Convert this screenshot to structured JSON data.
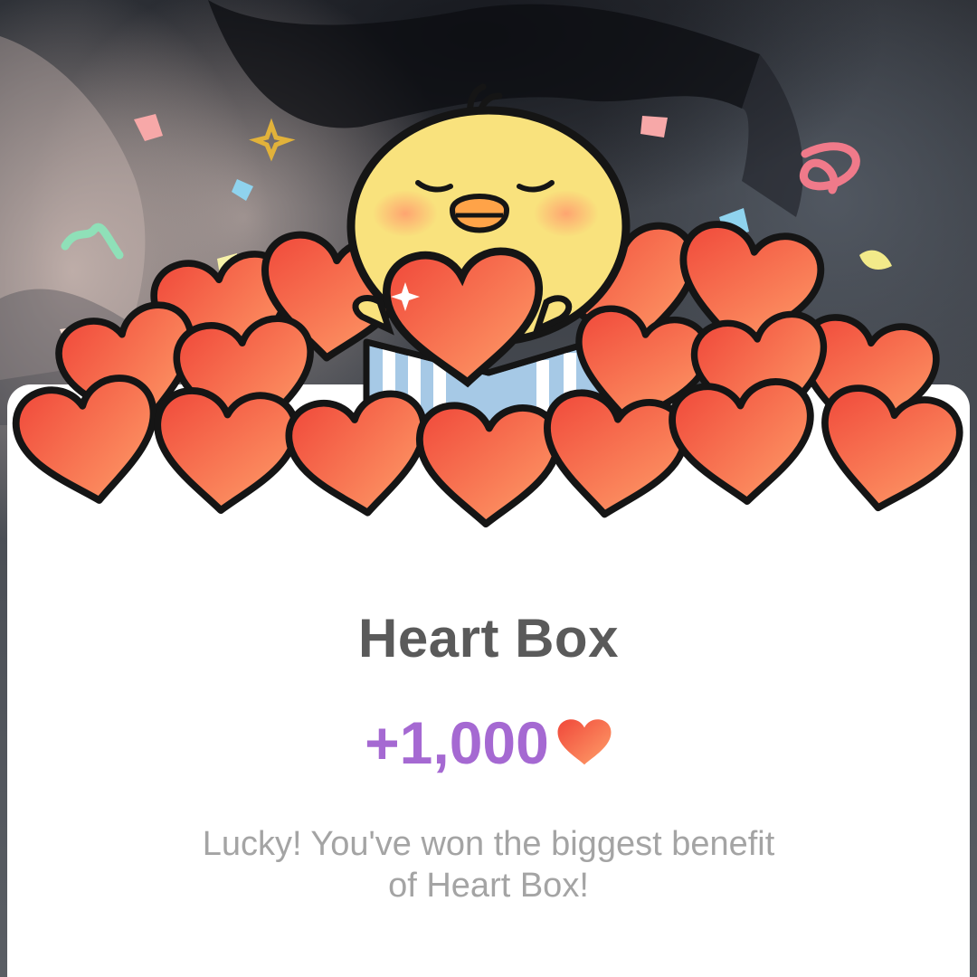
{
  "dialog": {
    "title": "Heart Box",
    "reward_amount": "+1,000",
    "reward_icon": "heart-icon",
    "message_line1": "Lucky! You've won the biggest benefit",
    "message_line2": "of Heart Box!"
  },
  "illustration": {
    "character": "chick-icon",
    "items": "heart-icon",
    "decorations": "confetti"
  },
  "colors": {
    "title": "#5a5a5a",
    "reward": "#a569d2",
    "message": "#a4a4a4",
    "heart_light": "#ffa06a",
    "heart_dark": "#f0483a",
    "chick": "#f9e27d"
  }
}
